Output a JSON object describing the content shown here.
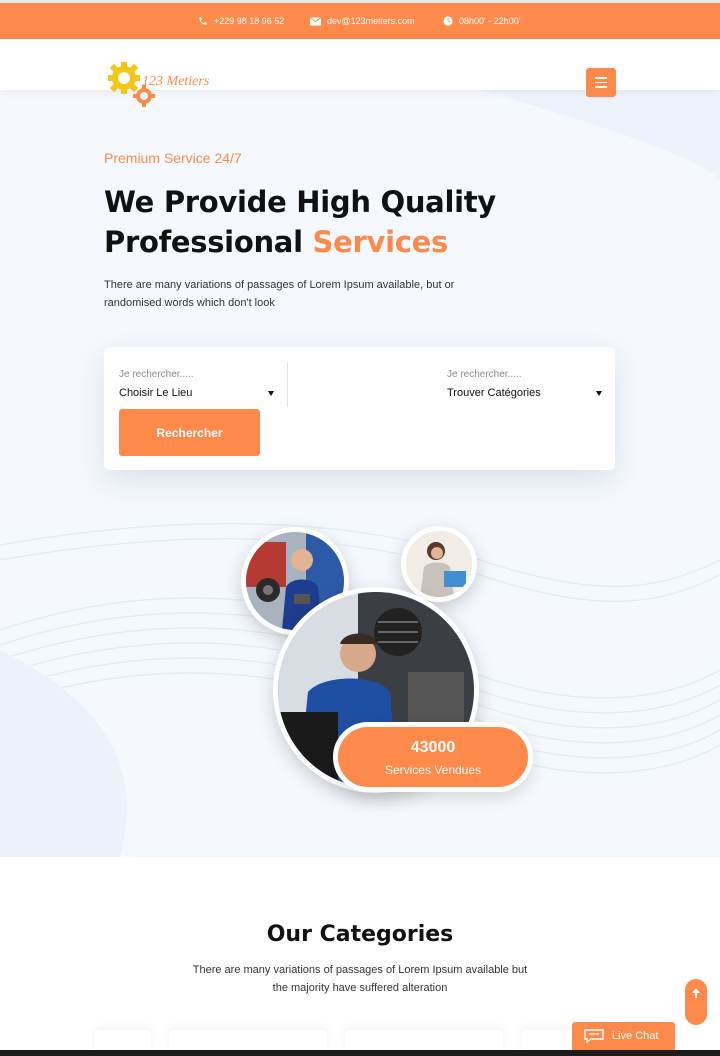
{
  "topbar": {
    "phone": "+229 98 18 96 52",
    "email": "dev@123metiers.com",
    "hours": "08h00' - 22h00'"
  },
  "brand": {
    "logo_text": "123 Metiers"
  },
  "hero": {
    "tagline": "Premium Service 24/7",
    "headline_line1": "We Provide High Quality",
    "headline_line2": "Professional",
    "headline_accent": "Services",
    "lead": "There are many variations of passages of Lorem Ipsum available, but or randomised words which don't look"
  },
  "search": {
    "location_label": "Je rechercher.....",
    "location_value": "Choisir Le Lieu",
    "category_label": "Je rechercher.....",
    "category_value": "Trouver Catégories",
    "button_label": "Rechercher"
  },
  "stats": {
    "value": "43000",
    "label": "Services Vendues"
  },
  "categories": {
    "title": "Our Categories",
    "subtitle": "There are many variations of passages of Lorem Ipsum available but the majority have suffered alteration"
  },
  "widgets": {
    "live_chat": "Live Chat"
  },
  "colors": {
    "accent": "#fd8a4b",
    "hero_bg": "#f5f8fd"
  }
}
